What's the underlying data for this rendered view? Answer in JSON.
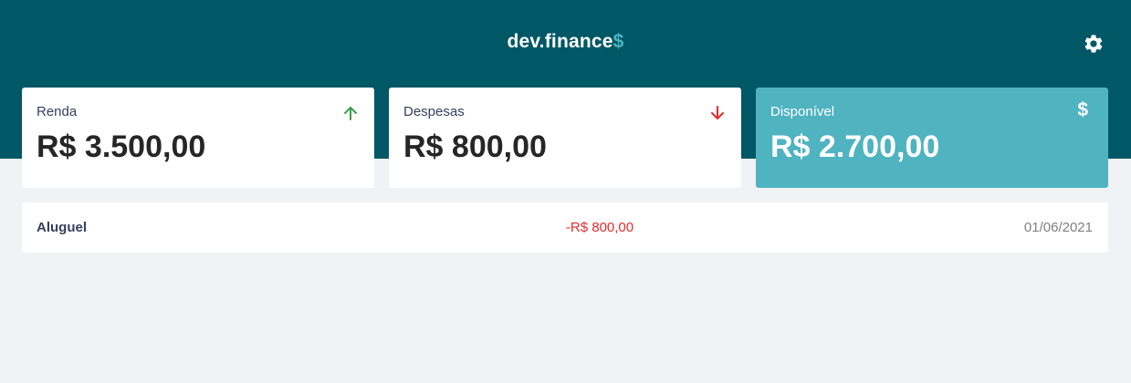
{
  "header": {
    "brand_name": "dev.finance",
    "brand_symbol": "$",
    "settings_icon": "gear-icon"
  },
  "summary": {
    "income": {
      "label": "Renda",
      "value": "R$ 3.500,00",
      "icon": "arrow-up-icon",
      "color": "#3aa14a"
    },
    "expenses": {
      "label": "Despesas",
      "value": "R$ 800,00",
      "icon": "arrow-down-icon",
      "color": "#e92929"
    },
    "available": {
      "label": "Disponível",
      "value": "R$ 2.700,00",
      "icon": "dollar-icon",
      "symbol": "$",
      "color": "#4fb3c0"
    }
  },
  "transactions": [
    {
      "description": "Aluguel",
      "amount": "-R$ 800,00",
      "date": "01/06/2021"
    }
  ],
  "colors": {
    "header_bg": "#005765",
    "page_bg": "#f0f2f5",
    "accent": "#4fb3c0",
    "expense": "#e92929",
    "income": "#3aa14a"
  }
}
